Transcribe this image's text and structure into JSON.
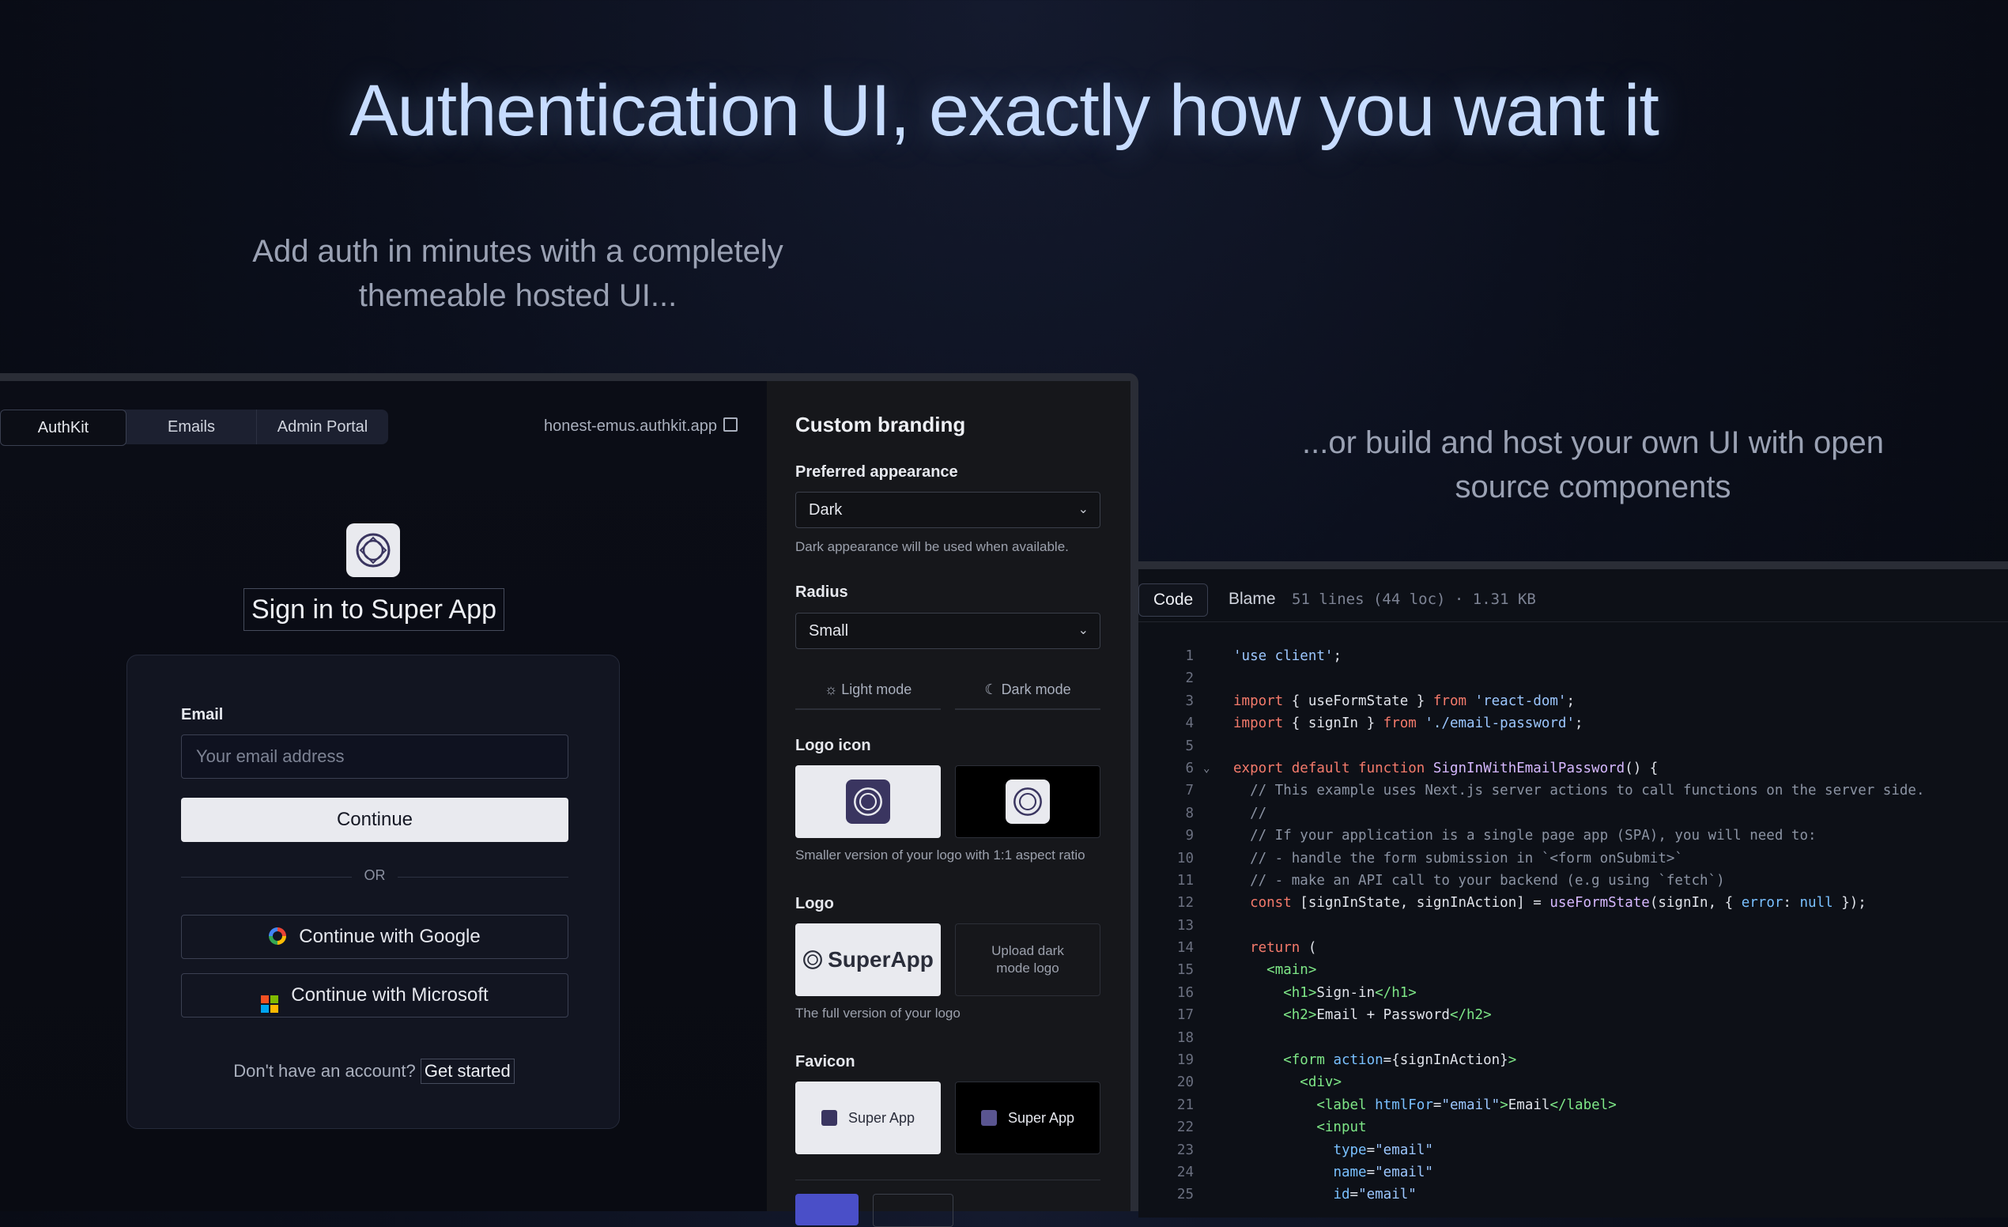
{
  "hero": {
    "title": "Authentication UI, exactly how you want it",
    "subtitle_left": "Add auth in minutes with a completely themeable hosted UI...",
    "subtitle_right": "...or build and host your own UI with open source components"
  },
  "preview": {
    "tabs": [
      "AuthKit",
      "Emails",
      "Admin Portal"
    ],
    "url": "honest-emus.authkit.app",
    "sign_in_title": "Sign in to Super App",
    "email_label": "Email",
    "email_placeholder": "Your email address",
    "continue_label": "Continue",
    "or_label": "OR",
    "google_label": "Continue with Google",
    "microsoft_label": "Continue with Microsoft",
    "signup_text": "Don't have an account?",
    "signup_link": "Get started"
  },
  "branding": {
    "title": "Custom branding",
    "appearance_label": "Preferred appearance",
    "appearance_value": "Dark",
    "appearance_help": "Dark appearance will be used when available.",
    "radius_label": "Radius",
    "radius_value": "Small",
    "light_mode": "Light mode",
    "dark_mode": "Dark mode",
    "logo_icon_label": "Logo icon",
    "logo_icon_help": "Smaller version of your logo with 1:1 aspect ratio",
    "logo_label": "Logo",
    "logo_text": "SuperApp",
    "upload_dark_logo": "Upload dark mode logo",
    "logo_help": "The full version of your logo",
    "favicon_label": "Favicon",
    "favicon_text_light": "Super App",
    "favicon_text_dark": "Super App"
  },
  "code": {
    "tab_code": "Code",
    "tab_blame": "Blame",
    "meta": "51 lines (44 loc) · 1.31 KB",
    "line_numbers": [
      "1",
      "2",
      "3",
      "4",
      "5",
      "6",
      "7",
      "8",
      "9",
      "10",
      "11",
      "12",
      "13",
      "14",
      "15",
      "16",
      "17",
      "18",
      "19",
      "20",
      "21",
      "22",
      "23",
      "24",
      "25"
    ]
  },
  "colors": {
    "accent": "#4a4fc8",
    "title_glow": "#c7dcff"
  }
}
